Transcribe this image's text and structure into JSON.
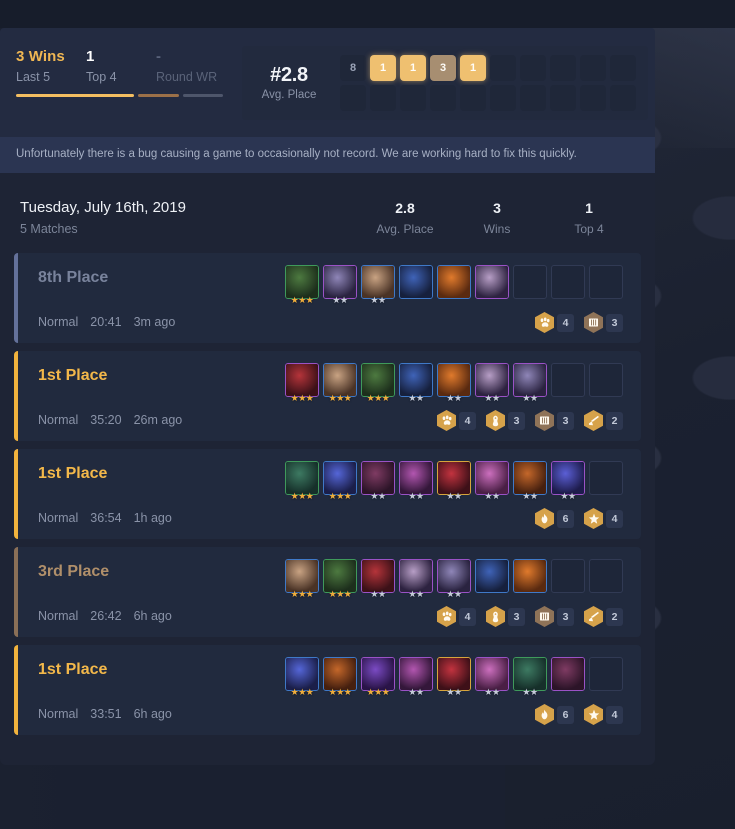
{
  "summary": {
    "streaks": [
      {
        "value": "3 Wins",
        "label": "Last 5"
      },
      {
        "value": "1",
        "label": "Top 4"
      },
      {
        "value": "-",
        "label": "Round WR"
      }
    ],
    "avg_place_value": "#2.8",
    "avg_place_label": "Avg. Place",
    "placements": [
      "8",
      "1",
      "1",
      "3",
      "1"
    ],
    "placement_kinds": [
      "loss",
      "win",
      "win",
      "top",
      "win"
    ],
    "grid_columns": 10,
    "grid_rows": 2
  },
  "notice": {
    "text": "Unfortunately there is a bug causing a game to occasionally not record. We are working hard to fix this quickly."
  },
  "day": {
    "title": "Tuesday, July 16th, 2019",
    "subtitle": "5 Matches",
    "stats": [
      {
        "value": "2.8",
        "label": "Avg. Place"
      },
      {
        "value": "3",
        "label": "Wins"
      },
      {
        "value": "1",
        "label": "Top 4"
      }
    ]
  },
  "colors": {
    "gold": "#f3b84a",
    "bronze": "#b08f6a",
    "gray": "#79839c",
    "panel": "#212a3e",
    "card": "#232b41",
    "notice_bg": "#2b3552"
  },
  "matches": [
    {
      "place": "8th Place",
      "rank_class": "gray",
      "queue": "Normal",
      "duration": "20:41",
      "ago": "3m ago",
      "slots": 9,
      "champions": [
        {
          "stars": 3,
          "tier": "t2",
          "c1": "#4d7a40",
          "c2": "#1d2f1c"
        },
        {
          "stars": 2,
          "tier": "t4",
          "c1": "#8f86b8",
          "c2": "#2a2340"
        },
        {
          "stars": 2,
          "tier": "t3",
          "c1": "#c9a383",
          "c2": "#4a3326"
        },
        {
          "stars": 0,
          "tier": "t3",
          "c1": "#3f63b8",
          "c2": "#16203d"
        },
        {
          "stars": 0,
          "tier": "t3",
          "c1": "#e07a2c",
          "c2": "#5a2a10"
        },
        {
          "stars": 0,
          "tier": "t4",
          "c1": "#b79ec6",
          "c2": "#2d2240"
        }
      ],
      "traits": [
        {
          "icon": "paw-icon",
          "style": "gold",
          "count": "4"
        },
        {
          "icon": "book-icon",
          "style": "bronze",
          "count": "3"
        }
      ]
    },
    {
      "place": "1st Place",
      "rank_class": "gold",
      "queue": "Normal",
      "duration": "35:20",
      "ago": "26m ago",
      "slots": 9,
      "champions": [
        {
          "stars": 3,
          "tier": "t4",
          "c1": "#b5343a",
          "c2": "#3c1118"
        },
        {
          "stars": 3,
          "tier": "t3",
          "c1": "#c9a383",
          "c2": "#4a3326"
        },
        {
          "stars": 3,
          "tier": "t2",
          "c1": "#4d7a40",
          "c2": "#1d2f1c"
        },
        {
          "stars": 2,
          "tier": "t3",
          "c1": "#3f63b8",
          "c2": "#16203d"
        },
        {
          "stars": 2,
          "tier": "t3",
          "c1": "#e07a2c",
          "c2": "#5a2a10"
        },
        {
          "stars": 2,
          "tier": "t4",
          "c1": "#b79ec6",
          "c2": "#2d2240"
        },
        {
          "stars": 2,
          "tier": "t4",
          "c1": "#8f86b8",
          "c2": "#2a2340"
        }
      ],
      "traits": [
        {
          "icon": "paw-icon",
          "style": "gold",
          "count": "4"
        },
        {
          "icon": "robot-icon",
          "style": "gold",
          "count": "3"
        },
        {
          "icon": "book-icon",
          "style": "bronze",
          "count": "3"
        },
        {
          "icon": "blade-icon",
          "style": "gold",
          "count": "2"
        }
      ]
    },
    {
      "place": "1st Place",
      "rank_class": "gold",
      "queue": "Normal",
      "duration": "36:54",
      "ago": "1h ago",
      "slots": 9,
      "champions": [
        {
          "stars": 3,
          "tier": "t2",
          "c1": "#3d7a62",
          "c2": "#16302a"
        },
        {
          "stars": 3,
          "tier": "t3",
          "c1": "#5566d8",
          "c2": "#1b1f4a"
        },
        {
          "stars": 2,
          "tier": "t4",
          "c1": "#7f3b63",
          "c2": "#2c1428"
        },
        {
          "stars": 2,
          "tier": "t4",
          "c1": "#b256b0",
          "c2": "#34173a"
        },
        {
          "stars": 2,
          "tier": "t5",
          "c1": "#c2333f",
          "c2": "#3e1018"
        },
        {
          "stars": 2,
          "tier": "t4",
          "c1": "#cc6fbe",
          "c2": "#4a1f45"
        },
        {
          "stars": 2,
          "tier": "t3",
          "c1": "#c4672a",
          "c2": "#46200f"
        },
        {
          "stars": 2,
          "tier": "t4",
          "c1": "#5b5fd6",
          "c2": "#1e1c4c"
        }
      ],
      "traits": [
        {
          "icon": "flame-icon",
          "style": "gold",
          "count": "6"
        },
        {
          "icon": "star-icon",
          "style": "gold",
          "count": "4"
        }
      ]
    },
    {
      "place": "3rd Place",
      "rank_class": "bronze",
      "queue": "Normal",
      "duration": "26:42",
      "ago": "6h ago",
      "slots": 9,
      "champions": [
        {
          "stars": 3,
          "tier": "t3",
          "c1": "#c9a383",
          "c2": "#4a3326"
        },
        {
          "stars": 3,
          "tier": "t2",
          "c1": "#4d7a40",
          "c2": "#1d2f1c"
        },
        {
          "stars": 2,
          "tier": "t4",
          "c1": "#b5343a",
          "c2": "#3c1118"
        },
        {
          "stars": 2,
          "tier": "t4",
          "c1": "#b79ec6",
          "c2": "#2d2240"
        },
        {
          "stars": 2,
          "tier": "t4",
          "c1": "#8f86b8",
          "c2": "#2a2340"
        },
        {
          "stars": 0,
          "tier": "t3",
          "c1": "#3f63b8",
          "c2": "#16203d"
        },
        {
          "stars": 0,
          "tier": "t3",
          "c1": "#e07a2c",
          "c2": "#5a2a10"
        }
      ],
      "traits": [
        {
          "icon": "paw-icon",
          "style": "gold",
          "count": "4"
        },
        {
          "icon": "robot-icon",
          "style": "gold",
          "count": "3"
        },
        {
          "icon": "book-icon",
          "style": "bronze",
          "count": "3"
        },
        {
          "icon": "blade-icon",
          "style": "gold",
          "count": "2"
        }
      ]
    },
    {
      "place": "1st Place",
      "rank_class": "gold",
      "queue": "Normal",
      "duration": "33:51",
      "ago": "6h ago",
      "slots": 9,
      "champions": [
        {
          "stars": 3,
          "tier": "t3",
          "c1": "#5566d8",
          "c2": "#1b1f4a"
        },
        {
          "stars": 3,
          "tier": "t3",
          "c1": "#c4672a",
          "c2": "#46200f"
        },
        {
          "stars": 3,
          "tier": "t4",
          "c1": "#7b4bc4",
          "c2": "#2a1448"
        },
        {
          "stars": 2,
          "tier": "t4",
          "c1": "#b256b0",
          "c2": "#34173a"
        },
        {
          "stars": 2,
          "tier": "t5",
          "c1": "#c2333f",
          "c2": "#3e1018"
        },
        {
          "stars": 2,
          "tier": "t4",
          "c1": "#cc6fbe",
          "c2": "#4a1f45"
        },
        {
          "stars": 2,
          "tier": "t2",
          "c1": "#3d7a62",
          "c2": "#16302a"
        },
        {
          "stars": 0,
          "tier": "t4",
          "c1": "#7f3b63",
          "c2": "#2c1428"
        }
      ],
      "traits": [
        {
          "icon": "flame-icon",
          "style": "gold",
          "count": "6"
        },
        {
          "icon": "star-icon",
          "style": "gold",
          "count": "4"
        }
      ]
    }
  ]
}
